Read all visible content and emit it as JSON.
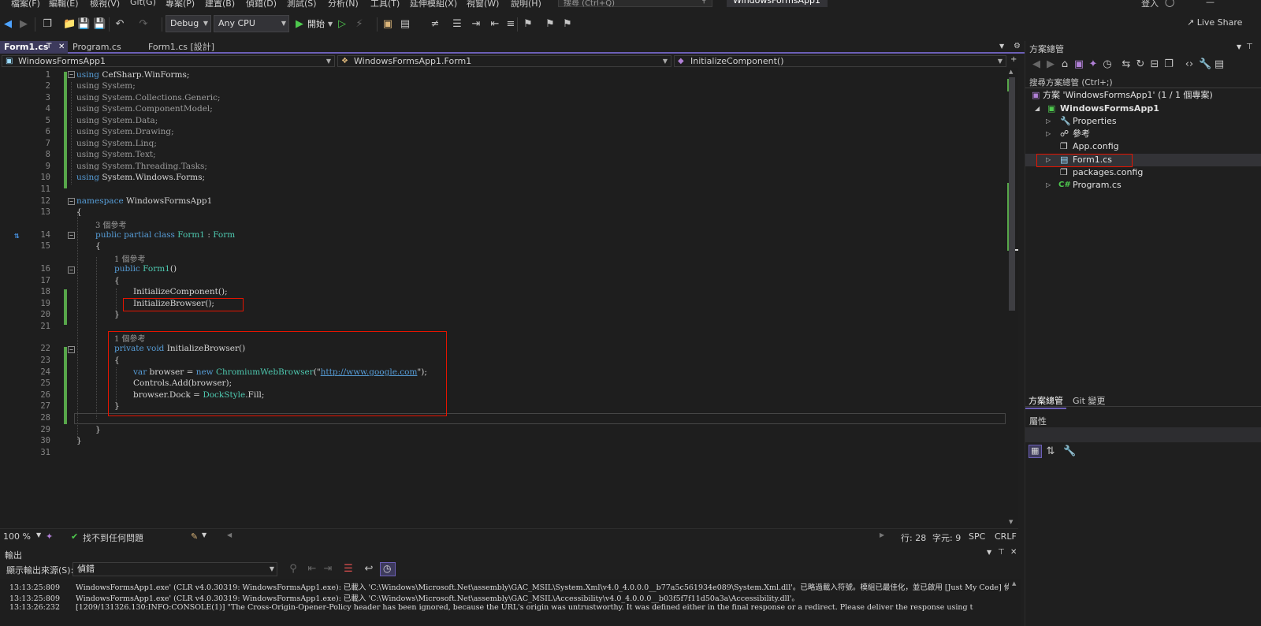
{
  "menu": {
    "items": [
      "檔案(F)",
      "編輯(E)",
      "檢視(V)",
      "Git(G)",
      "專案(P)",
      "建置(B)",
      "偵錯(D)",
      "測試(S)",
      "分析(N)",
      "工具(T)",
      "延伸模組(X)",
      "視窗(W)",
      "說明(H)"
    ],
    "search_placeholder": "搜尋 (Ctrl+Q)",
    "window_title": "WindowsFormsApp1",
    "login": "登入",
    "live_share": "Live Share"
  },
  "toolbar": {
    "config": "Debug",
    "platform": "Any CPU",
    "start_label": "開始"
  },
  "tabs": [
    {
      "label": "Form1.cs",
      "active": true
    },
    {
      "label": "Program.cs",
      "active": false
    },
    {
      "label": "Form1.cs [設計]",
      "active": false
    }
  ],
  "navbar": {
    "project": "WindowsFormsApp1",
    "class": "WindowsFormsApp1.Form1",
    "member": "InitializeComponent()"
  },
  "editor": {
    "line_numbers": [
      "1",
      "2",
      "3",
      "4",
      "5",
      "6",
      "7",
      "8",
      "9",
      "10",
      "11",
      "12",
      "13",
      "14",
      "15",
      "16",
      "17",
      "18",
      "19",
      "20",
      "21",
      "22",
      "23",
      "24",
      "25",
      "26",
      "27",
      "28",
      "29",
      "30",
      "31"
    ],
    "using_kw": "using",
    "usings": [
      "CefSharp.WinForms;",
      "System;",
      "System.Collections.Generic;",
      "System.ComponentModel;",
      "System.Data;",
      "System.Drawing;",
      "System.Linq;",
      "System.Text;",
      "System.Threading.Tasks;",
      "System.Windows.Forms;"
    ],
    "namespace_kw": "namespace",
    "namespace_name": "WindowsFormsApp1",
    "open_brace": "{",
    "close_brace": "}",
    "lens_3": "3 個參考",
    "lens_1": "1 個參考",
    "class_decl_kw": "public partial class",
    "class_name": "Form1",
    "class_sep": " : ",
    "class_base": "Form",
    "ctor_kw": "public",
    "ctor_name": "Form1",
    "ctor_parens": "()",
    "call_init_component": "InitializeComponent();",
    "call_init_browser": "InitializeBrowser();",
    "method_kw": "private void",
    "method_name": "InitializeBrowser",
    "method_parens": "()",
    "var_kw": "var",
    "var_browser": " browser = ",
    "new_kw": "new",
    "browser_type": "ChromiumWebBrowser",
    "paren_open": "(\"",
    "url": "http://www.google.com",
    "paren_close": "\");",
    "controls_add": "Controls.Add(browser);",
    "dock_prefix": "browser.Dock = ",
    "dock_type": "DockStyle",
    "dock_suffix": ".Fill;"
  },
  "editor_status": {
    "zoom": "100 %",
    "issues": "找不到任何問題",
    "line": "行: 28",
    "col": "字元: 9",
    "spc": "SPC",
    "crlf": "CRLF"
  },
  "output": {
    "title": "輸出",
    "source_label": "顯示輸出來源(S):",
    "source_value": "偵錯",
    "lines": [
      {
        "time": "13:13:25:809",
        "text": "WindowsFormsApp1.exe' (CLR v4.0.30319: WindowsFormsApp1.exe): 已載入 'C:\\Windows\\Microsoft.Net\\assembly\\GAC_MSIL\\System.Xml\\v4.0_4.0.0.0__b77a5c561934e089\\System.Xml.dll'。已略過載入符號。模組已最佳化，並已啟用 [Just My Code] 偵錯"
      },
      {
        "time": "13:13:25:809",
        "text": "WindowsFormsApp1.exe' (CLR v4.0.30319: WindowsFormsApp1.exe): 已載入 'C:\\Windows\\Microsoft.Net\\assembly\\GAC_MSIL\\Accessibility\\v4.0_4.0.0.0__b03f5f7f11d50a3a\\Accessibility.dll'。"
      },
      {
        "time": "13:13:26:232",
        "text": "[1209/131326.130:INFO:CONSOLE(1)] \"The Cross-Origin-Opener-Policy header has been ignored, because the URL's origin was untrustworthy. It was defined either in the final response or a redirect. Please deliver the response using t"
      }
    ]
  },
  "solution_explorer": {
    "title": "方案總管",
    "search": "搜尋方案總管 (Ctrl+;)",
    "solution": "方案 'WindowsFormsApp1' (1 / 1 個專案)",
    "project": "WindowsFormsApp1",
    "items": [
      "Properties",
      "參考",
      "App.config",
      "Form1.cs",
      "packages.config",
      "Program.cs"
    ],
    "bottom_tabs": [
      "方案總管",
      "Git 變更"
    ]
  },
  "properties": {
    "title": "屬性"
  },
  "colors": {
    "accent": "#6c5fb7",
    "highlight_box": "#e51400",
    "keyword": "#569cd6",
    "type": "#4ec9b0",
    "change_bar": "#57a64a"
  }
}
